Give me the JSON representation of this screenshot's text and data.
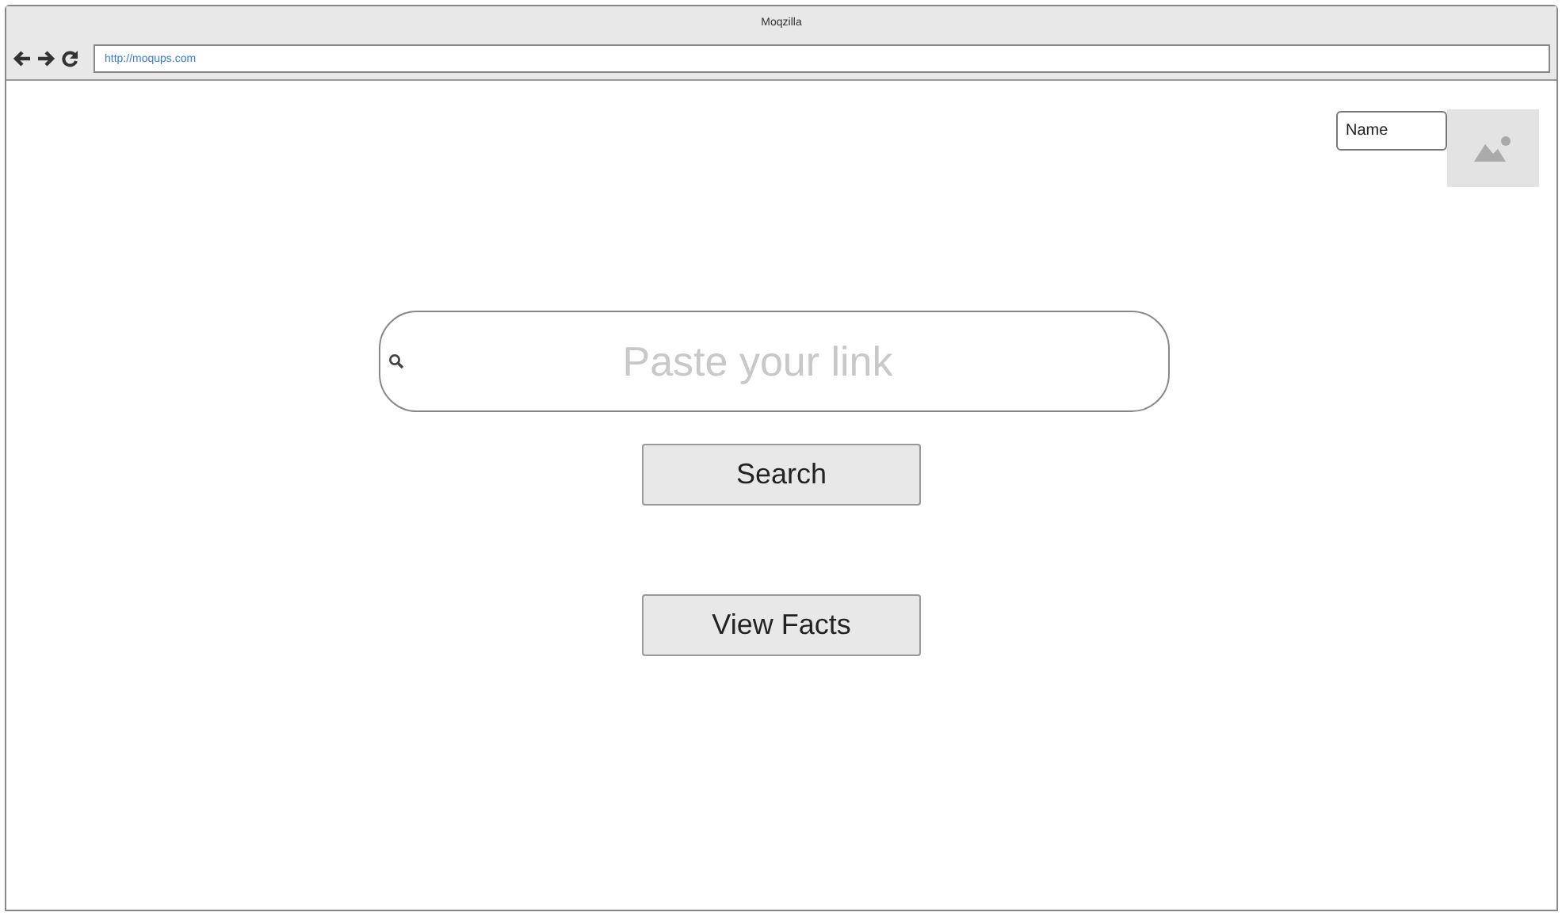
{
  "window": {
    "title": "Moqzilla"
  },
  "address_bar": {
    "value": "http://moqups.com"
  },
  "name_field": {
    "value": "Name"
  },
  "search": {
    "placeholder": "Paste your link"
  },
  "buttons": [
    "Search",
    "View Facts"
  ]
}
